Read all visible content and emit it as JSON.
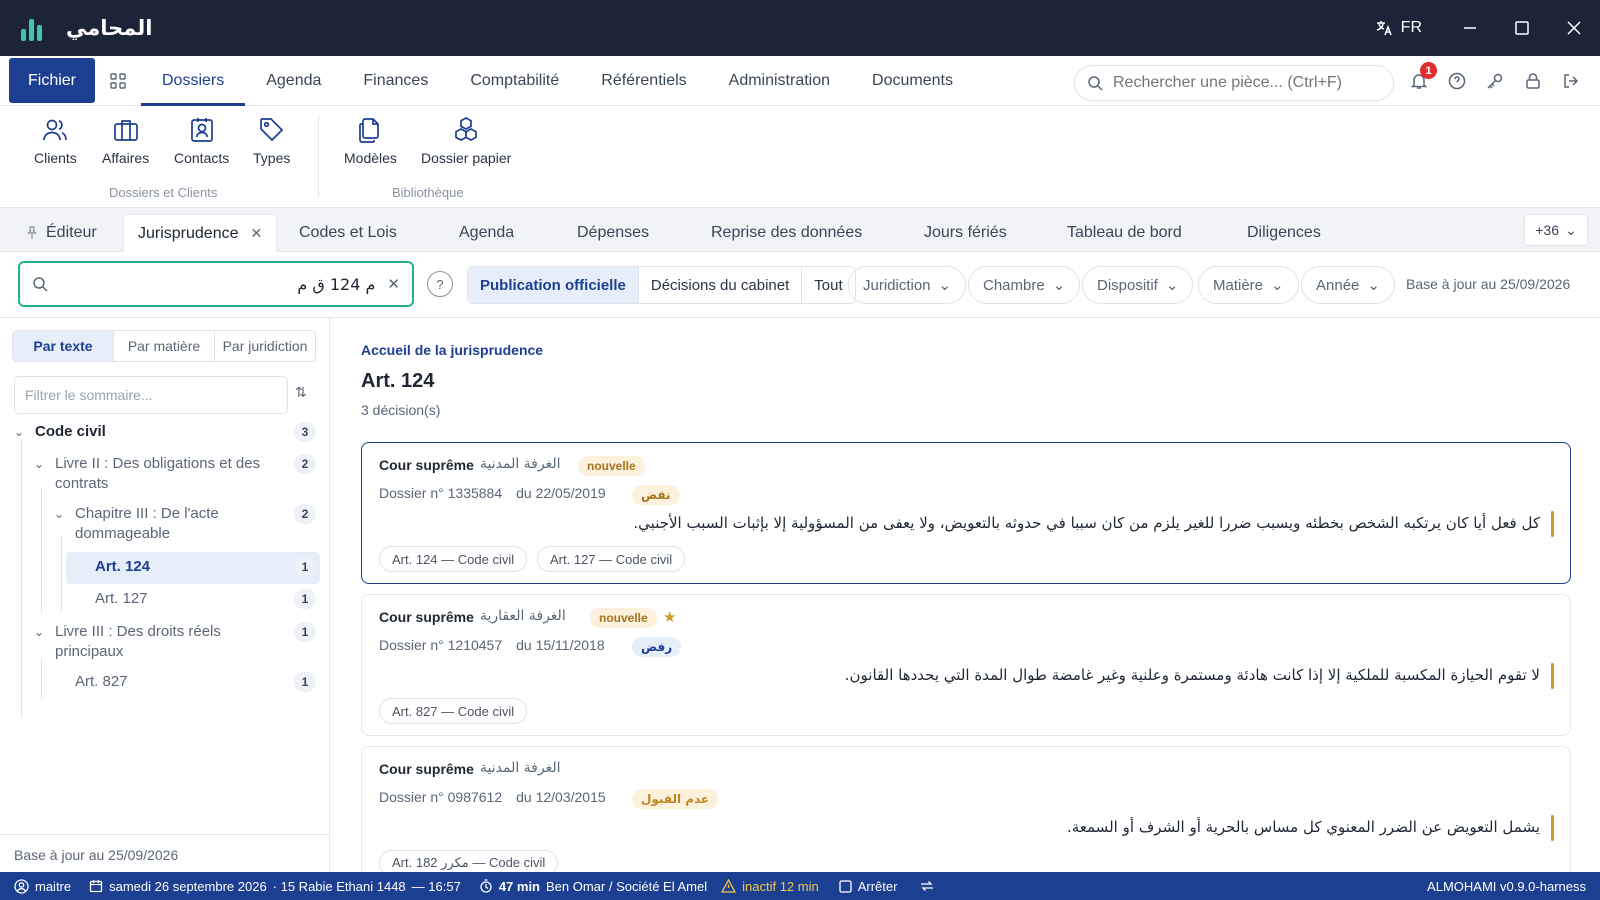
{
  "app": {
    "name": "المحامي",
    "lang": "FR"
  },
  "menu": {
    "fichier": "Fichier",
    "items": [
      "Dossiers",
      "Agenda",
      "Finances",
      "Comptabilité",
      "Référentiels",
      "Administration",
      "Documents"
    ],
    "search_placeholder": "Rechercher une pièce... (Ctrl+F)",
    "notifications": "1"
  },
  "ribbon": {
    "clients": "Clients",
    "affaires": "Affaires",
    "contacts": "Contacts",
    "types": "Types",
    "modeles": "Modèles",
    "dossier_papier": "Dossier papier",
    "group1": "Dossiers et Clients",
    "group2": "Bibliothèque"
  },
  "tabs": {
    "editeur": "Éditeur",
    "jurisprudence": "Jurisprudence",
    "codes": "Codes et Lois",
    "agenda": "Agenda",
    "depenses": "Dépenses",
    "reprise": "Reprise des données",
    "feries": "Jours fériés",
    "tableau": "Tableau de bord",
    "diligences": "Diligences",
    "more": "+36"
  },
  "filters": {
    "query": "م 124 ق م",
    "seg_official": "Publication officielle",
    "seg_cabinet": "Décisions du cabinet",
    "seg_all": "Tout",
    "juridiction": "Juridiction",
    "chambre": "Chambre",
    "dispositif": "Dispositif",
    "matiere": "Matière",
    "annee": "Année",
    "base_date": "Base à jour au 25/09/2026"
  },
  "sidebar": {
    "seg_text": "Par texte",
    "seg_matiere": "Par matière",
    "seg_juridiction": "Par juridiction",
    "filter_placeholder": "Filtrer le sommaire...",
    "tree": {
      "code_civil": {
        "label": "Code civil",
        "count": "3"
      },
      "livre2_a": {
        "label": "Livre II : Des obligations et des",
        "count": "2"
      },
      "livre2_b": {
        "label": "contrats"
      },
      "chap3_a": {
        "label": "Chapitre III : De l'acte",
        "count": "2"
      },
      "chap3_b": {
        "label": "dommageable"
      },
      "art124": {
        "label": "Art. 124",
        "count": "1"
      },
      "art127": {
        "label": "Art. 127",
        "count": "1"
      },
      "livre3_a": {
        "label": "Livre III : Des droits réels",
        "count": "1"
      },
      "livre3_b": {
        "label": "principaux"
      },
      "art827": {
        "label": "Art. 827",
        "count": "1"
      }
    },
    "footer": "Base à jour au 25/09/2026"
  },
  "content": {
    "breadcrumb": "Accueil de la jurisprudence",
    "title": "Art. 124",
    "count": "3 décision(s)",
    "cards": [
      {
        "court": "Cour suprême",
        "chamber": "الغرفة المدنية",
        "tag": "nouvelle",
        "dossier": "Dossier n° 1335884",
        "date": "du 22/05/2019",
        "outcome": "نقض",
        "text": "كل فعل أيا كان يرتكبه الشخص بخطئه ويسبب ضررا للغير يلزم من كان سببا في حدوثه بالتعويض، ولا يعفى من المسؤولية إلا بإثبات السبب الأجنبي.",
        "chips": [
          "Art. 124 — Code civil",
          "Art. 127 — Code civil"
        ]
      },
      {
        "court": "Cour suprême",
        "chamber": "الغرفة العقارية",
        "tag": "nouvelle",
        "dossier": "Dossier n° 1210457",
        "date": "du 15/11/2018",
        "outcome": "رفض",
        "text": "لا تقوم الحيازة المكسبة للملكية إلا إذا كانت هادئة ومستمرة وعلنية وغير غامضة طوال المدة التي يحددها القانون.",
        "chips": [
          "Art. 827 — Code civil"
        ]
      },
      {
        "court": "Cour suprême",
        "chamber": "الغرفة المدنية",
        "dossier": "Dossier n° 0987612",
        "date": "du 12/03/2015",
        "outcome": "عدم القبول",
        "text": "يشمل التعويض عن الضرر المعنوي كل مساس بالحرية أو الشرف أو السمعة.",
        "chips": [
          "Art. 182 مكرر — Code civil"
        ]
      }
    ]
  },
  "status": {
    "user": "maitre",
    "date": "samedi 26 septembre 2026",
    "hijri": "· 15 Rabie Ethani 1448",
    "time": "— 16:57",
    "duration": "47 min",
    "client": "Ben Omar / Société El Amel",
    "inactive": "inactif 12 min",
    "stop": "Arrêter",
    "version": "ALMOHAMI v0.9.0-harness"
  },
  "colors": {
    "accent": "#1d3f91",
    "titlebar": "#1b2537",
    "search_focus": "#23b08d",
    "gold": "#c99a2c"
  }
}
